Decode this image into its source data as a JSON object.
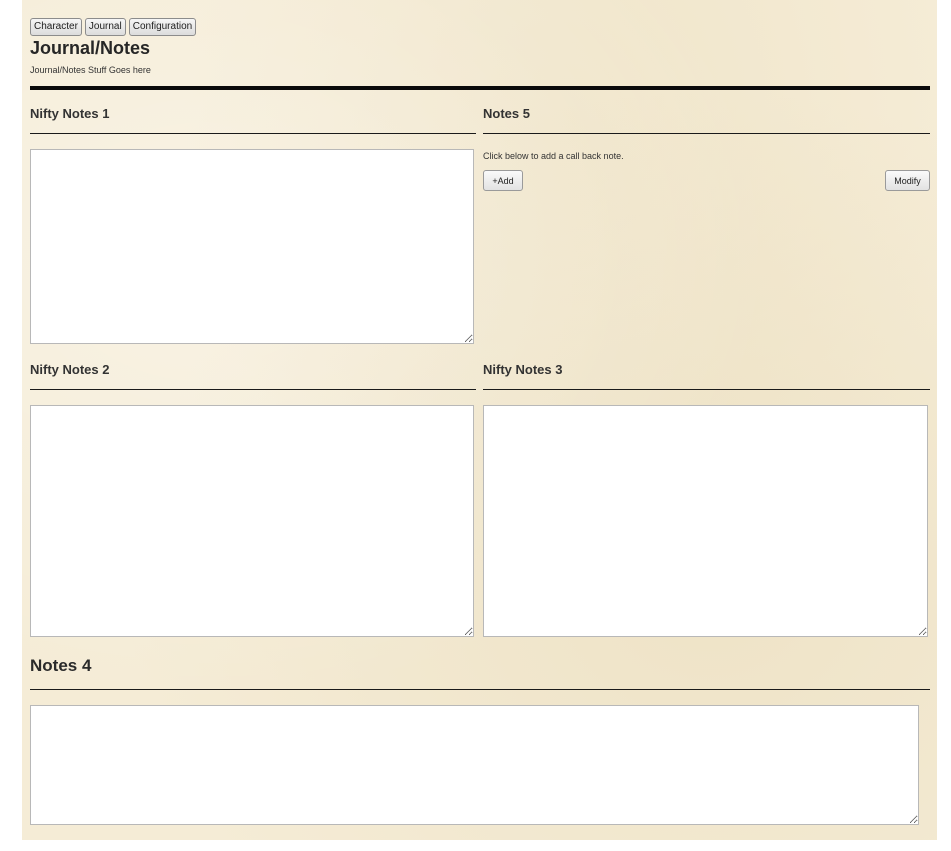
{
  "tabs": [
    {
      "label": "Character"
    },
    {
      "label": "Journal"
    },
    {
      "label": "Configuration"
    }
  ],
  "header": {
    "title": "Journal/Notes",
    "subtitle": "Journal/Notes Stuff Goes here"
  },
  "sections": {
    "nifty1": {
      "title": "Nifty Notes 1",
      "value": ""
    },
    "notes5": {
      "title": "Notes 5",
      "hint": "Click below to add a call back note.",
      "add_label": "+Add",
      "modify_label": "Modify"
    },
    "nifty2": {
      "title": "Nifty Notes 2",
      "value": ""
    },
    "nifty3": {
      "title": "Nifty Notes 3",
      "value": ""
    },
    "notes4": {
      "title": "Notes 4",
      "value": ""
    }
  },
  "colors": {
    "parchment": "#f5ecd6",
    "rule": "#0a0a0a"
  }
}
